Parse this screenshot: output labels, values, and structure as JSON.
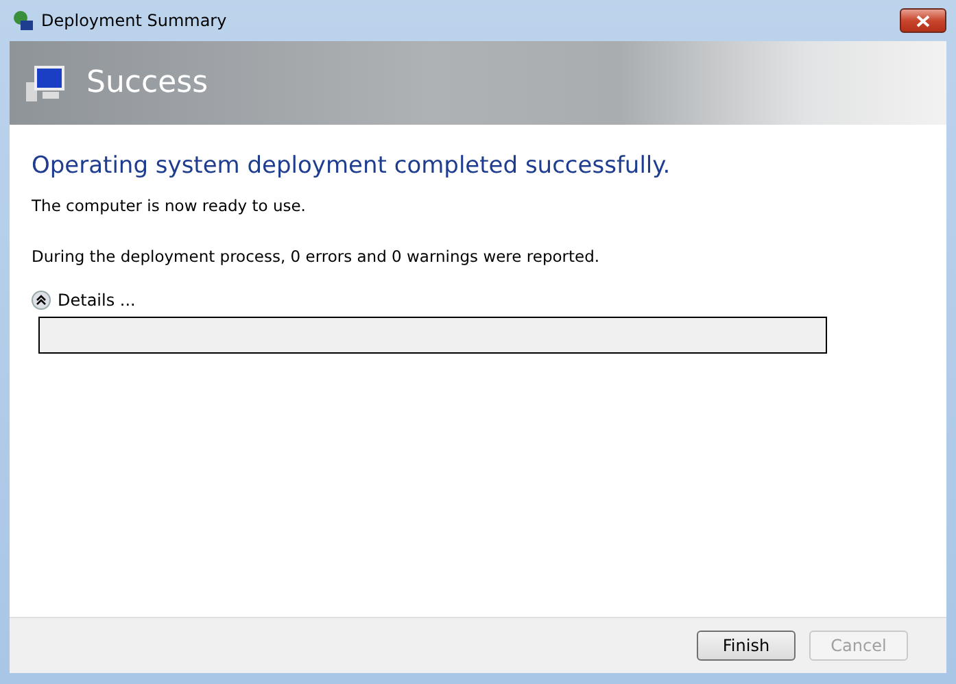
{
  "window": {
    "title": "Deployment Summary"
  },
  "banner": {
    "title": "Success"
  },
  "heading": "Operating system deployment completed successfully.",
  "messages": [
    "The computer is now ready to use.",
    "During the deployment process, 0 errors and 0 warnings were reported."
  ],
  "details": {
    "label": "Details ...",
    "expanded": true
  },
  "buttons": [
    {
      "label": "Finish",
      "disabled": false
    },
    {
      "label": "Cancel",
      "disabled": true
    }
  ]
}
